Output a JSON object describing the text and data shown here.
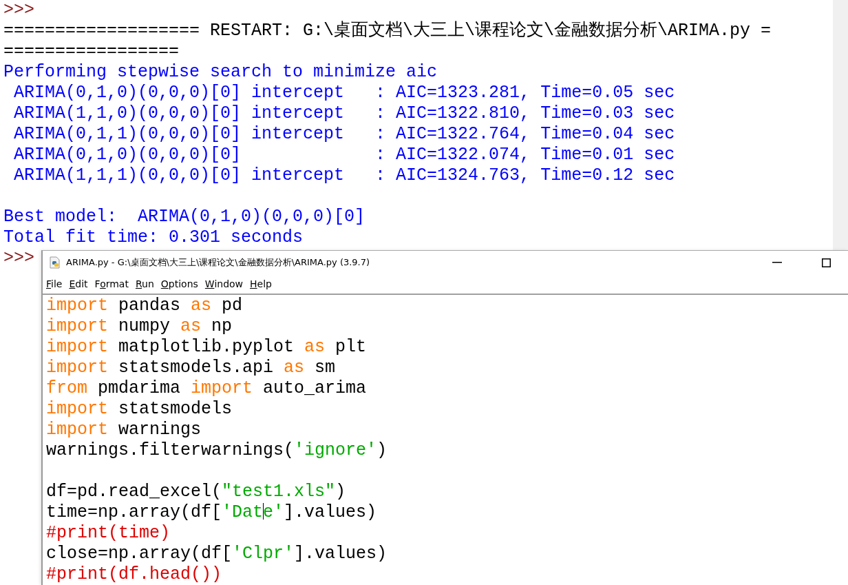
{
  "shell": {
    "lines": [
      {
        "kind": "text",
        "segments": [
          {
            "kind": "prompt",
            "text": ">>>"
          }
        ]
      },
      {
        "kind": "text",
        "segments": [
          {
            "kind": "plain",
            "text": "=================== RESTART: G:\\桌面文档\\大三上\\课程论文\\金融数据分析\\ARIMA.py ="
          }
        ]
      },
      {
        "kind": "text",
        "segments": [
          {
            "kind": "plain",
            "text": "================="
          }
        ]
      },
      {
        "kind": "text",
        "segments": [
          {
            "kind": "output",
            "text": "Performing stepwise search to minimize aic"
          }
        ]
      },
      {
        "kind": "text",
        "segments": [
          {
            "kind": "output",
            "text": " ARIMA(0,1,0)(0,0,0)[0] intercept   : AIC=1323.281, Time=0.05 sec"
          }
        ]
      },
      {
        "kind": "text",
        "segments": [
          {
            "kind": "output",
            "text": " ARIMA(1,1,0)(0,0,0)[0] intercept   : AIC=1322.810, Time=0.03 sec"
          }
        ]
      },
      {
        "kind": "text",
        "segments": [
          {
            "kind": "output",
            "text": " ARIMA(0,1,1)(0,0,0)[0] intercept   : AIC=1322.764, Time=0.04 sec"
          }
        ]
      },
      {
        "kind": "text",
        "segments": [
          {
            "kind": "output",
            "text": " ARIMA(0,1,0)(0,0,0)[0]             : AIC=1322.074, Time=0.01 sec"
          }
        ]
      },
      {
        "kind": "text",
        "segments": [
          {
            "kind": "output",
            "text": " ARIMA(1,1,1)(0,0,0)[0] intercept   : AIC=1324.763, Time=0.12 sec"
          }
        ]
      },
      {
        "kind": "blank"
      },
      {
        "kind": "text",
        "segments": [
          {
            "kind": "output",
            "text": "Best model:  ARIMA(0,1,0)(0,0,0)[0]"
          }
        ]
      },
      {
        "kind": "text",
        "segments": [
          {
            "kind": "output",
            "text": "Total fit time: 0.301 seconds"
          }
        ]
      },
      {
        "kind": "text",
        "segments": [
          {
            "kind": "prompt",
            "text": ">>>"
          }
        ]
      }
    ]
  },
  "editor": {
    "title": "ARIMA.py - G:\\桌面文档\\大三上\\课程论文\\金融数据分析\\ARIMA.py (3.9.7)",
    "menu": [
      {
        "key": "F",
        "post": "ile"
      },
      {
        "key": "E",
        "post": "dit"
      },
      {
        "pre": "F",
        "key": "o",
        "post": "rmat"
      },
      {
        "key": "R",
        "post": "un"
      },
      {
        "key": "O",
        "post": "ptions"
      },
      {
        "key": "W",
        "post": "indow"
      },
      {
        "key": "H",
        "post": "elp"
      }
    ],
    "lines": [
      {
        "kind": "text",
        "segments": [
          {
            "kind": "keyword",
            "text": "import"
          },
          {
            "kind": "plain",
            "text": " pandas "
          },
          {
            "kind": "keyword",
            "text": "as"
          },
          {
            "kind": "plain",
            "text": " pd"
          }
        ]
      },
      {
        "kind": "text",
        "segments": [
          {
            "kind": "keyword",
            "text": "import"
          },
          {
            "kind": "plain",
            "text": " numpy "
          },
          {
            "kind": "keyword",
            "text": "as"
          },
          {
            "kind": "plain",
            "text": " np"
          }
        ]
      },
      {
        "kind": "text",
        "segments": [
          {
            "kind": "keyword",
            "text": "import"
          },
          {
            "kind": "plain",
            "text": " matplotlib.pyplot "
          },
          {
            "kind": "keyword",
            "text": "as"
          },
          {
            "kind": "plain",
            "text": " plt"
          }
        ]
      },
      {
        "kind": "text",
        "segments": [
          {
            "kind": "keyword",
            "text": "import"
          },
          {
            "kind": "plain",
            "text": " statsmodels.api "
          },
          {
            "kind": "keyword",
            "text": "as"
          },
          {
            "kind": "plain",
            "text": " sm"
          }
        ]
      },
      {
        "kind": "text",
        "segments": [
          {
            "kind": "keyword",
            "text": "from"
          },
          {
            "kind": "plain",
            "text": " pmdarima "
          },
          {
            "kind": "keyword",
            "text": "import"
          },
          {
            "kind": "plain",
            "text": " auto_arima"
          }
        ]
      },
      {
        "kind": "text",
        "segments": [
          {
            "kind": "keyword",
            "text": "import"
          },
          {
            "kind": "plain",
            "text": " statsmodels"
          }
        ]
      },
      {
        "kind": "text",
        "segments": [
          {
            "kind": "keyword",
            "text": "import"
          },
          {
            "kind": "plain",
            "text": " warnings"
          }
        ]
      },
      {
        "kind": "text",
        "segments": [
          {
            "kind": "plain",
            "text": "warnings.filterwarnings("
          },
          {
            "kind": "string",
            "text": "'ignore'"
          },
          {
            "kind": "plain",
            "text": ")"
          }
        ]
      },
      {
        "kind": "blank"
      },
      {
        "kind": "text",
        "segments": [
          {
            "kind": "plain",
            "text": "df=pd.read_excel("
          },
          {
            "kind": "string",
            "text": "\"test1.xls\""
          },
          {
            "kind": "plain",
            "text": ")"
          }
        ]
      },
      {
        "kind": "text",
        "segments": [
          {
            "kind": "plain",
            "text": "time=np.array(df["
          },
          {
            "kind": "string",
            "text": "'Dat"
          },
          {
            "kind": "cursor"
          },
          {
            "kind": "string",
            "text": "e'"
          },
          {
            "kind": "plain",
            "text": "].values)"
          }
        ]
      },
      {
        "kind": "text",
        "segments": [
          {
            "kind": "comment",
            "text": "#print(time)"
          }
        ]
      },
      {
        "kind": "text",
        "segments": [
          {
            "kind": "plain",
            "text": "close=np.array(df["
          },
          {
            "kind": "string",
            "text": "'Clpr'"
          },
          {
            "kind": "plain",
            "text": "].values)"
          }
        ]
      },
      {
        "kind": "text",
        "segments": [
          {
            "kind": "comment",
            "text": "#print(df.head())"
          }
        ]
      }
    ]
  }
}
